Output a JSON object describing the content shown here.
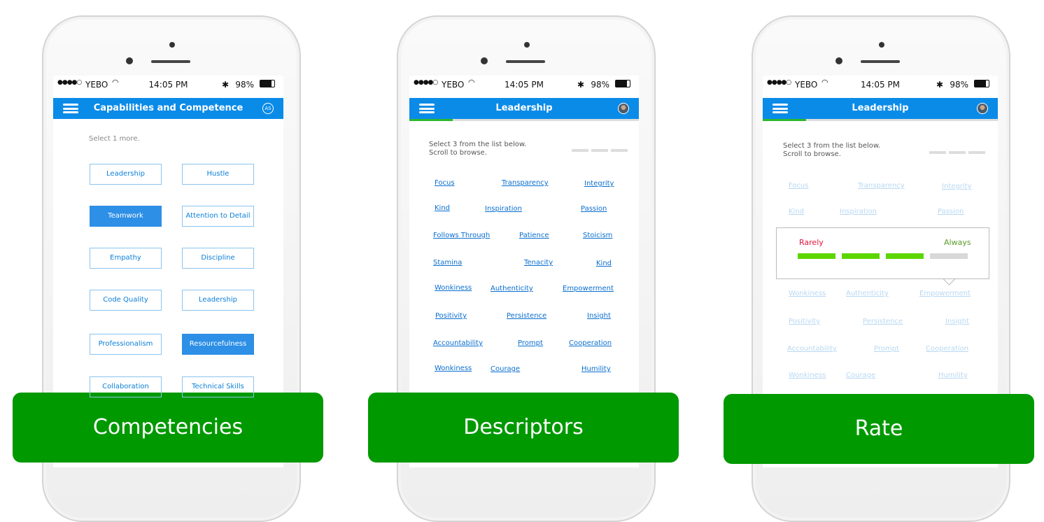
{
  "status": {
    "carrier": "YEBO",
    "time": "14:05 PM",
    "battery": "98%"
  },
  "colors": {
    "header": "#0a8be8",
    "selected": "#2d8fe6",
    "label_bg": "#009900",
    "rarely": "#e0143c",
    "always": "#5a9a2a",
    "rating_on": "#5cd600",
    "rating_off": "#d8d8d8"
  },
  "screens": [
    {
      "title": "Capabilities and Competence",
      "avatar": "AS",
      "hint": "Select 1 more.",
      "chips": [
        {
          "label": "Leadership",
          "selected": false
        },
        {
          "label": "Hustle",
          "selected": false
        },
        {
          "label": "Teamwork",
          "selected": true
        },
        {
          "label": "Attention to Detail",
          "selected": false
        },
        {
          "label": "Empathy",
          "selected": false
        },
        {
          "label": "Discipline",
          "selected": false
        },
        {
          "label": "Code Quality",
          "selected": false
        },
        {
          "label": "Leadership",
          "selected": false
        },
        {
          "label": "Professionalism",
          "selected": false
        },
        {
          "label": "Resourcefulness",
          "selected": true
        },
        {
          "label": "Collaboration",
          "selected": false
        },
        {
          "label": "Technical Skills",
          "selected": false
        }
      ],
      "caption": "Competencies"
    },
    {
      "title": "Leadership",
      "hint": "Select 3 from the list below.\nScroll to browse.",
      "words": [
        "Focus",
        "Transparency",
        "Integrity",
        "Kind",
        "Inspiration",
        "Passion",
        "Follows Through",
        "Patience",
        "Stoicism",
        "Stamina",
        "Tenacity",
        "Kind",
        "Wonkiness",
        "Authenticity",
        "Empowerment",
        "Positivity",
        "Persistence",
        "Insight",
        "Accountability",
        "Prompt",
        "Cooperation",
        "Wonkiness",
        "Courage",
        "Humility"
      ],
      "caption": "Descriptors"
    },
    {
      "title": "Leadership",
      "hint": "Select 3 from the list below.\nScroll to browse.",
      "words": [
        "Focus",
        "Transparency",
        "Integrity",
        "Kind",
        "Inspiration",
        "Passion",
        "Wonkiness",
        "Authenticity",
        "Empowerment",
        "Positivity",
        "Persistence",
        "Insight",
        "Accountability",
        "Prompt",
        "Cooperation",
        "Wonkiness",
        "Courage",
        "Humility"
      ],
      "rating": {
        "low_label": "Rarely",
        "high_label": "Always",
        "value": 3,
        "max": 4
      },
      "caption": "Rate"
    }
  ]
}
